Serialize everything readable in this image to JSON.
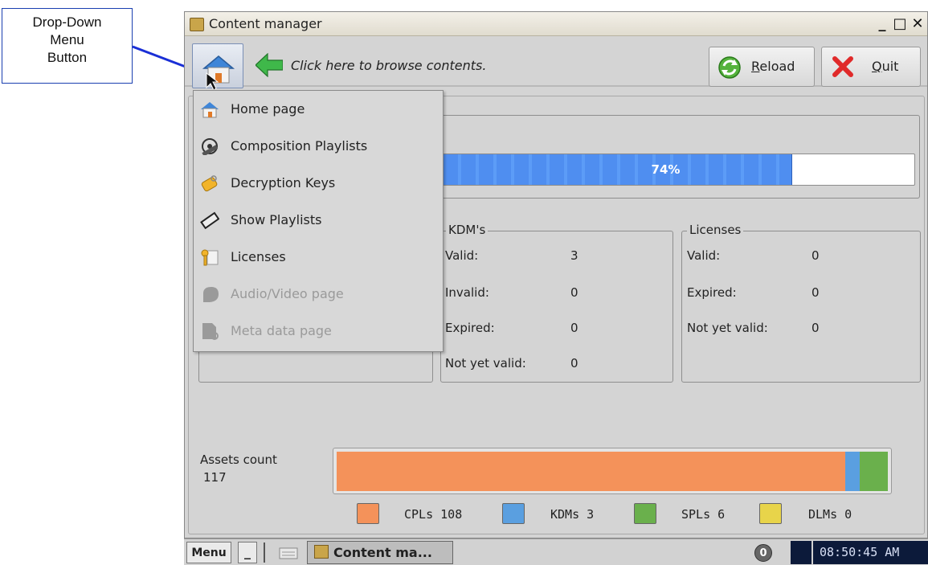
{
  "callout": {
    "lines": [
      "Drop-Down",
      "Menu",
      "Button"
    ]
  },
  "window": {
    "title": "Content manager",
    "controls": {
      "minimize": "_",
      "maximize": "□",
      "close": "✕"
    }
  },
  "toolbar": {
    "browse_hint": "Click here to browse contents.",
    "reload_label": "Reload",
    "reload_mnemonic": "R",
    "reload_rest": "eload",
    "quit_label": "Quit",
    "quit_mnemonic": "Q",
    "quit_rest": "uit"
  },
  "dropdown_menu": {
    "items": [
      {
        "label": "Home page",
        "icon": "home-icon",
        "enabled": true
      },
      {
        "label": "Composition Playlists",
        "icon": "film-reel-icon",
        "enabled": true
      },
      {
        "label": "Decryption Keys",
        "icon": "key-tag-icon",
        "enabled": true
      },
      {
        "label": "Show Playlists",
        "icon": "film-strip-icon",
        "enabled": true
      },
      {
        "label": "Licenses",
        "icon": "license-key-icon",
        "enabled": true
      },
      {
        "label": "Audio/Video page",
        "icon": "audio-video-icon",
        "enabled": false
      },
      {
        "label": "Meta data page",
        "icon": "metadata-icon",
        "enabled": false
      }
    ]
  },
  "progress": {
    "percent": 74,
    "text": "74%",
    "fill_color": "#4f8ef0"
  },
  "kdms": {
    "title": "KDM's",
    "rows": [
      {
        "label": "Valid:",
        "value": "3"
      },
      {
        "label": "Invalid:",
        "value": "0"
      },
      {
        "label": "Expired:",
        "value": "0"
      },
      {
        "label": "Not yet valid:",
        "value": "0"
      }
    ]
  },
  "licenses": {
    "title": "Licenses",
    "rows": [
      {
        "label": "Valid:",
        "value": "0"
      },
      {
        "label": "Expired:",
        "value": "0"
      },
      {
        "label": "Not yet valid:",
        "value": "0"
      }
    ]
  },
  "assets": {
    "label": "Assets count",
    "count": "117",
    "segments": [
      {
        "name": "CPLs",
        "value": 108,
        "color": "#f4925a"
      },
      {
        "name": "KDMs",
        "value": 3,
        "color": "#5a9fe0"
      },
      {
        "name": "SPLs",
        "value": 6,
        "color": "#6ab04c"
      },
      {
        "name": "DLMs",
        "value": 0,
        "color": "#e8d44a"
      }
    ],
    "legend": [
      {
        "text": "CPLs 108",
        "color": "#f4925a"
      },
      {
        "text": "KDMs 3",
        "color": "#5a9fe0"
      },
      {
        "text": "SPLs 6",
        "color": "#6ab04c"
      },
      {
        "text": "DLMs 0",
        "color": "#e8d44a"
      }
    ]
  },
  "taskbar": {
    "menu_label": "Menu",
    "minimize_label": "_",
    "task_label": "Content ma...",
    "tray_badge": "0",
    "clock": "08:50:45 AM"
  }
}
